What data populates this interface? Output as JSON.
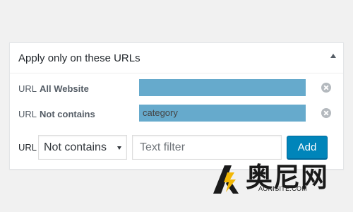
{
  "panel": {
    "title": "Apply only on these URLs",
    "toggle_icon": "collapse-up-icon"
  },
  "rules": [
    {
      "type": "URL",
      "condition": "All Website",
      "value": ""
    },
    {
      "type": "URL",
      "condition": "Not contains",
      "value": "category"
    }
  ],
  "add_rule": {
    "type_label": "URL",
    "select_value": "Not contains",
    "input_value": "",
    "input_placeholder": "Text filter",
    "button_label": "Add"
  },
  "watermark": {
    "brand": "奥尼网",
    "site": "AONISITE.COM"
  },
  "colors": {
    "highlight": "#66aacc",
    "button": "#0085ba",
    "remove_icon": "#b4b9be"
  }
}
